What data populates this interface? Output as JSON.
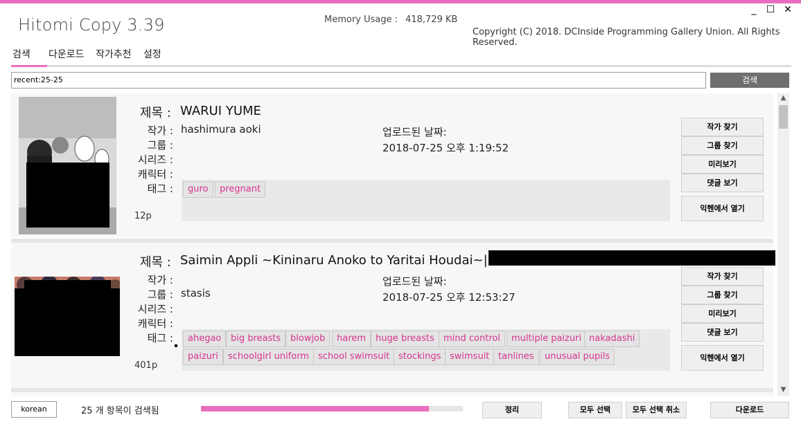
{
  "colors": {
    "accent": "#e86fc0",
    "tag_text": "#d6338f"
  },
  "window": {
    "title": "Hitomi Copy 3.39",
    "memory_label": "Memory Usage :",
    "memory_value": "418,729 KB",
    "copyright": "Copyright (C) 2018. DCInside Programming Gallery Union. All Rights Reserved.",
    "minimize": "_",
    "maximize": "☐",
    "close": "✕"
  },
  "tabs": [
    {
      "label": "검색"
    },
    {
      "label": "다운로드"
    },
    {
      "label": "작가추천"
    },
    {
      "label": "설정"
    }
  ],
  "search": {
    "value": "recent:25-25",
    "button": "검색"
  },
  "field_labels": {
    "title": "제목 :",
    "artist": "작가 :",
    "group": "그룹 :",
    "series": "시리즈 :",
    "character": "캐릭터 :",
    "tags": "태그 :",
    "uploaded": "업로드된 날짜:"
  },
  "side_buttons": {
    "find_artist": "작가 찾기",
    "find_group": "그룹 찾기",
    "preview": "미리보기",
    "comments": "댓글 보기",
    "open_exhentai": "익헨에서 열기"
  },
  "results": [
    {
      "title": "WARUI YUME",
      "artist": "hashimura aoki",
      "group": "",
      "uploaded": "2018-07-25 오후 1:19:52",
      "pages": "12p",
      "tags": [
        "guro",
        "pregnant"
      ]
    },
    {
      "title": "Saimin Appli ~Kininaru Anoko to Yaritai Houdai~|",
      "artist": "",
      "group": "stasis",
      "uploaded": "2018-07-25 오후 12:53:27",
      "pages": "401p",
      "tags": [
        "ahegao",
        "big breasts",
        "blowjob",
        "harem",
        "huge breasts",
        "mind control",
        "multiple paizuri",
        "nakadashi",
        "paizuri",
        "schoolgirl uniform",
        "school swimsuit",
        "stockings",
        "swimsuit",
        "tanlines",
        "unusual pupils"
      ]
    }
  ],
  "bottom": {
    "language": "korean",
    "status": "25 개 항목이 검색됨",
    "progress": 0.87,
    "tidy": "정리",
    "select_all": "모두 선택",
    "deselect_all": "모두 선택 취소",
    "download": "다운로드"
  }
}
